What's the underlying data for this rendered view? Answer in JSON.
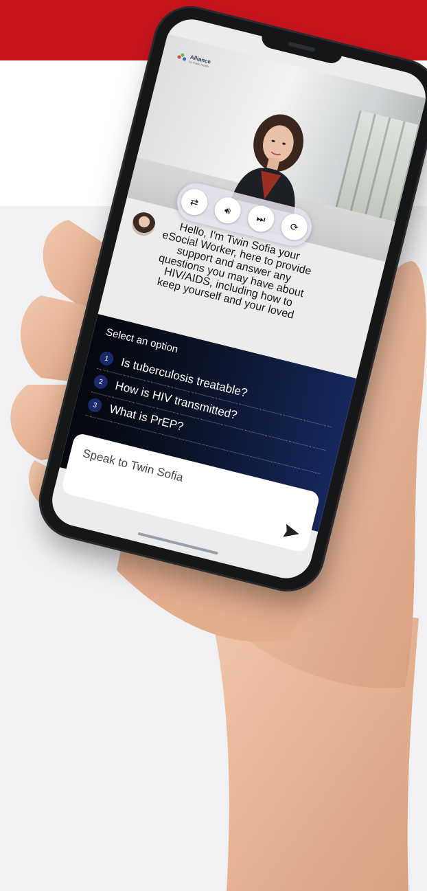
{
  "brand": {
    "logo_name": "Alliance",
    "logo_tagline": "for Public Health"
  },
  "video": {
    "controls": [
      "repeat-icon",
      "volume-icon",
      "skip-icon",
      "refresh-icon"
    ]
  },
  "chat": {
    "message": "Hello, I'm Twin Sofia your eSocial Worker, here to provide support and answer any questions you may have about HIV/AIDS, including how to keep yourself and your loved"
  },
  "options": {
    "title": "Select an option",
    "items": [
      {
        "num": "1",
        "label": "Is tuberculosis treatable?"
      },
      {
        "num": "2",
        "label": "How is HIV transmitted?"
      },
      {
        "num": "3",
        "label": "What is PrEP?"
      }
    ]
  },
  "input": {
    "placeholder": "Speak to Twin Sofia"
  },
  "colors": {
    "accent_red": "#c8141b",
    "panel_dark": "#0b1224",
    "panel_blue": "#15265c"
  }
}
